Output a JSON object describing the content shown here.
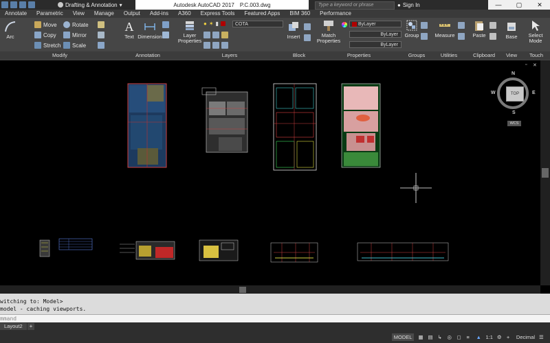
{
  "app": {
    "title": "Autodesk AutoCAD 2017",
    "file": "P.C.003.dwg"
  },
  "workspace": {
    "label": "Drafting & Annotation"
  },
  "search": {
    "placeholder": "Type a keyword or phrase"
  },
  "user": {
    "signin_label": "Sign In"
  },
  "window_controls": [
    "—",
    "▢",
    "✕"
  ],
  "ribbon_tabs": [
    "Annotate",
    "Parametric",
    "View",
    "Manage",
    "Output",
    "Add-ins",
    "A360",
    "Express Tools",
    "Featured Apps",
    "BIM 360",
    "Performance"
  ],
  "ribbon": {
    "modify": {
      "title": "Modify",
      "arc": "Arc",
      "move": "Move",
      "copy": "Copy",
      "stretch": "Stretch",
      "rotate": "Rotate",
      "mirror": "Mirror",
      "scale": "Scale"
    },
    "annotation": {
      "title": "Annotation",
      "text": "Text",
      "dimension": "Dimension"
    },
    "layers": {
      "title": "Layers",
      "layer_properties": "Layer Properties",
      "current_layer": "COTA"
    },
    "block": {
      "title": "Block",
      "insert": "Insert"
    },
    "properties": {
      "title": "Properties",
      "match": "Match Properties",
      "color": "ByLayer",
      "linetype": "ByLayer",
      "lineweight": "ByLayer"
    },
    "groups": {
      "title": "Groups",
      "group": "Group"
    },
    "utilities": {
      "title": "Utilities",
      "measure": "Measure"
    },
    "clipboard": {
      "title": "Clipboard",
      "paste": "Paste"
    },
    "view": {
      "title": "View",
      "base": "Base"
    },
    "touch": {
      "title": "Touch",
      "select_mode": "Select Mode"
    }
  },
  "viewcube": {
    "top_label": "TOP",
    "n": "N",
    "s": "S",
    "e": "E",
    "w": "W",
    "wcs": "WCS"
  },
  "command": {
    "history": [
      "witching to: Model>",
      "model - caching viewports."
    ],
    "input_placeholder": "mmand"
  },
  "layout_tabs": {
    "current": "Layout2",
    "add": "+"
  },
  "status": {
    "model": "MODEL",
    "scale": "1:1",
    "units": "Decimal"
  },
  "colors": {
    "ribbon_bg": "#464646",
    "titlebar_bg": "#2b2b2b",
    "canvas_bg": "#000000",
    "accent_blue": "#5a7fa8"
  }
}
